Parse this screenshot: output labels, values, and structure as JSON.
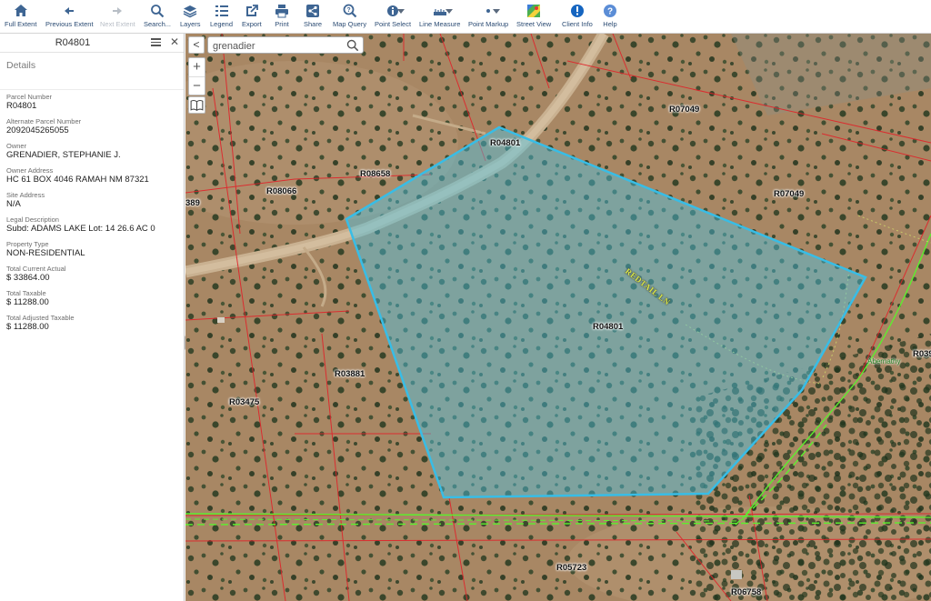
{
  "toolbar": {
    "items": [
      {
        "label": "Full Extent",
        "icon": "home-icon",
        "enabled": true
      },
      {
        "label": "Previous Extent",
        "icon": "arrow-left-icon",
        "enabled": true
      },
      {
        "label": "Next Extent",
        "icon": "arrow-right-icon",
        "enabled": false
      },
      {
        "label": "Search...",
        "icon": "search-icon",
        "enabled": true
      },
      {
        "label": "Layers",
        "icon": "layers-icon",
        "enabled": true
      },
      {
        "label": "Legend",
        "icon": "legend-icon",
        "enabled": true
      },
      {
        "label": "Export",
        "icon": "export-icon",
        "enabled": true
      },
      {
        "label": "Print",
        "icon": "print-icon",
        "enabled": true
      },
      {
        "label": "Share",
        "icon": "share-icon",
        "enabled": true
      },
      {
        "label": "Map Query",
        "icon": "map-query-icon",
        "enabled": true
      },
      {
        "label": "Point Select",
        "icon": "point-select-icon",
        "enabled": true
      },
      {
        "label": "Line Measure",
        "icon": "line-measure-icon",
        "enabled": true
      },
      {
        "label": "Point Markup",
        "icon": "point-markup-icon",
        "enabled": true
      },
      {
        "label": "Street View",
        "icon": "street-view-icon",
        "enabled": true
      },
      {
        "label": "Client Info",
        "icon": "info-icon",
        "enabled": true
      },
      {
        "label": "Help",
        "icon": "help-icon",
        "enabled": true
      }
    ]
  },
  "panel": {
    "title": "R04801",
    "section": "Details",
    "fields": [
      {
        "label": "Parcel Number",
        "value": "R04801"
      },
      {
        "label": "Alternate Parcel Number",
        "value": "2092045265055"
      },
      {
        "label": "Owner",
        "value": "GRENADIER, STEPHANIE J."
      },
      {
        "label": "Owner Address",
        "value": "HC 61 BOX 4046 RAMAH NM 87321"
      },
      {
        "label": "Site Address",
        "value": "N/A"
      },
      {
        "label": "Legal Description",
        "value": "Subd: ADAMS LAKE Lot: 14 26.6 AC 0"
      },
      {
        "label": "Property Type",
        "value": "NON-RESIDENTIAL"
      },
      {
        "label": "Total Current Actual",
        "value": "$ 33864.00"
      },
      {
        "label": "Total Taxable",
        "value": "$ 11288.00"
      },
      {
        "label": "Total Adjusted Taxable",
        "value": "$ 11288.00"
      }
    ]
  },
  "map": {
    "search_value": "grenadier",
    "back_glyph": "<",
    "zoom_in": "+",
    "zoom_out": "−",
    "parcel_labels": {
      "r04801_top": "R04801",
      "r04801_center": "R04801",
      "r08658": "R08658",
      "r08066": "R08066",
      "r07049_top": "R07049",
      "r07049_right": "R07049",
      "r03881": "R03881",
      "r03475": "R03475",
      "r05723": "R05723",
      "r06758": "R06758",
      "r0389_left": "389",
      "r039_right": "R039"
    },
    "street_label": "REDTAIL LN",
    "road_label": "Abernathy",
    "colors": {
      "selection_fill": "#4bc4e4",
      "selection_stroke": "#38bde6",
      "parcel_line": "#e0232a",
      "road_line": "#5cf02e"
    }
  }
}
